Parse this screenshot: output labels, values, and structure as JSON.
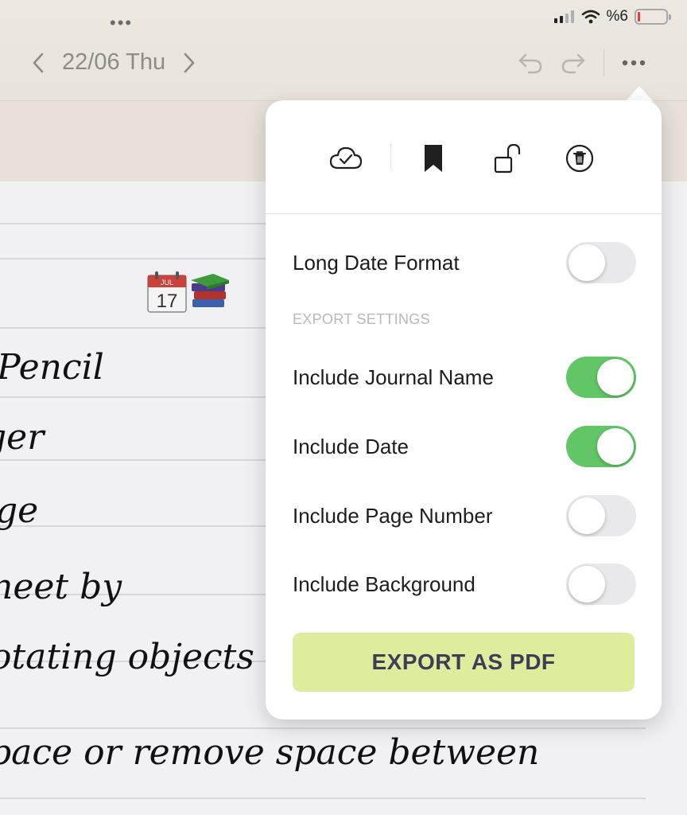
{
  "status_bar": {
    "battery_text": "%6",
    "multitask_dots": "•••"
  },
  "nav": {
    "prev_glyph": "‹",
    "next_glyph": "›",
    "date": "22/06 Thu",
    "more_glyph": "•••"
  },
  "page": {
    "stickers": [
      "calendar-sticker",
      "books-sticker"
    ],
    "calendar_sticker": {
      "month": "JUL",
      "day": "17"
    },
    "handwriting": [
      "Pencil",
      "ger",
      "ge",
      "neet by",
      "otating objects",
      "pace or remove space between"
    ]
  },
  "popover": {
    "icons": [
      "cloud-sync-icon",
      "bookmark-icon",
      "unlock-icon",
      "trash-icon"
    ],
    "settings": {
      "long_date": {
        "label": "Long Date Format",
        "on": false
      },
      "section_title": "EXPORT SETTINGS",
      "journal_name": {
        "label": "Include Journal Name",
        "on": true
      },
      "date": {
        "label": "Include Date",
        "on": true
      },
      "page_number": {
        "label": "Include Page Number",
        "on": false
      },
      "background": {
        "label": "Include Background",
        "on": false
      }
    },
    "export_button": "EXPORT AS PDF"
  },
  "colors": {
    "toggle_on": "#62c566",
    "toggle_off": "#e9e9eb",
    "export_bg": "#dced9e",
    "export_text": "#3f3d55"
  }
}
